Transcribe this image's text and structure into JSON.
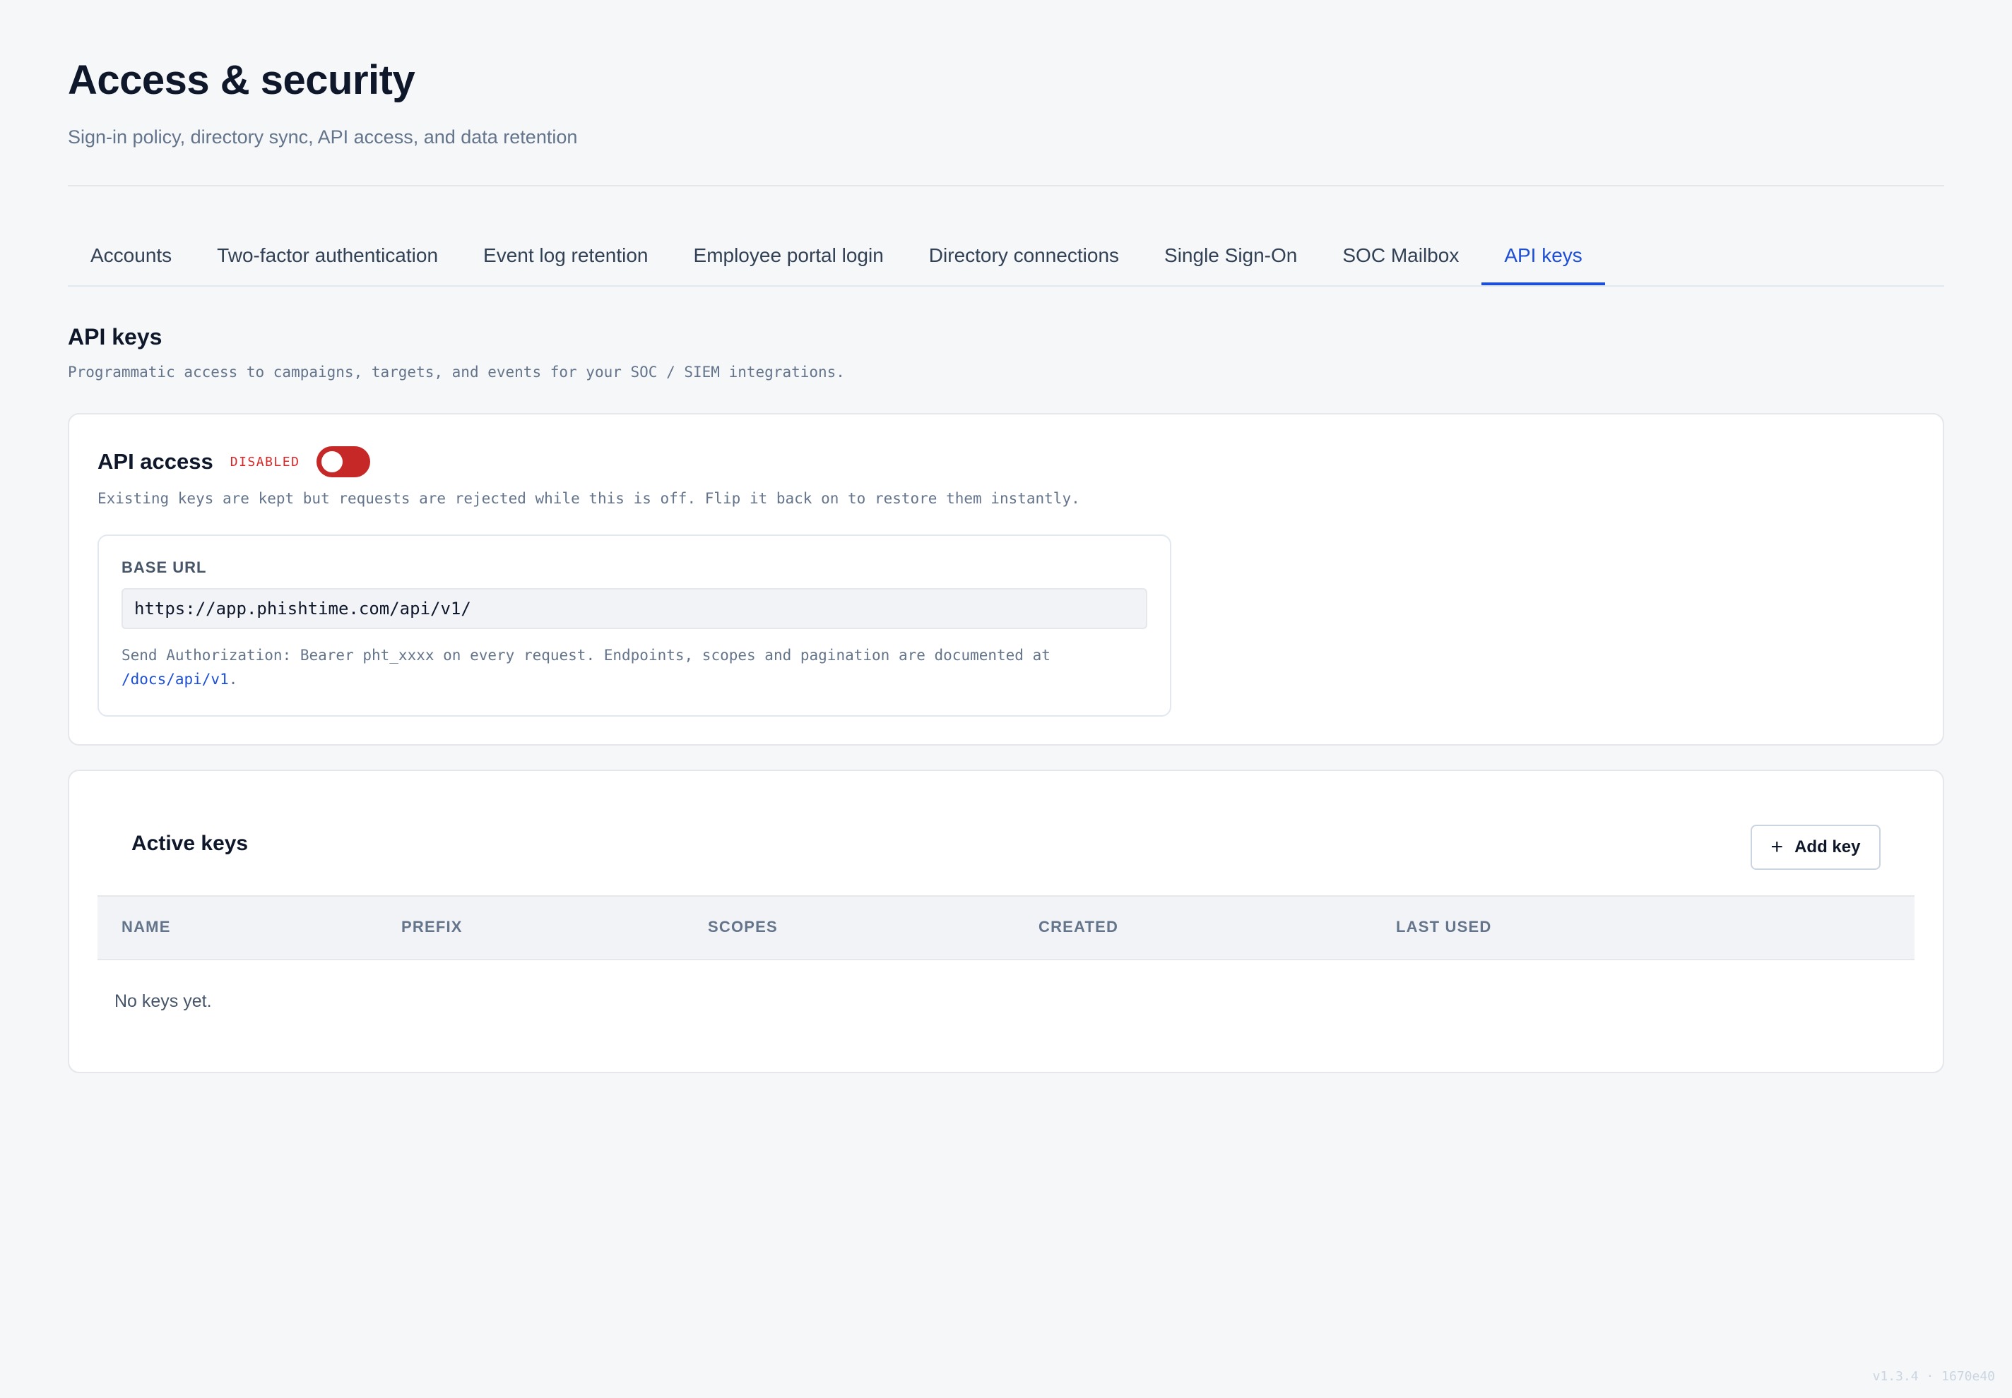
{
  "header": {
    "title": "Access & security",
    "subtitle": "Sign-in policy, directory sync, API access, and data retention"
  },
  "tabs": [
    {
      "label": "Accounts",
      "active": false
    },
    {
      "label": "Two-factor authentication",
      "active": false
    },
    {
      "label": "Event log retention",
      "active": false
    },
    {
      "label": "Employee portal login",
      "active": false
    },
    {
      "label": "Directory connections",
      "active": false
    },
    {
      "label": "Single Sign-On",
      "active": false
    },
    {
      "label": "SOC Mailbox",
      "active": false
    },
    {
      "label": "API keys",
      "active": true
    }
  ],
  "section": {
    "title": "API keys",
    "description": "Programmatic access to campaigns, targets, and events for your SOC / SIEM integrations."
  },
  "api_access": {
    "label": "API access",
    "status": "DISABLED",
    "enabled": false,
    "description": "Existing keys are kept but requests are rejected while this is off. Flip it back on to restore them instantly.",
    "base_url_label": "BASE URL",
    "base_url": "https://app.phishtime.com/api/v1/",
    "note_prefix": "Send Authorization: Bearer pht_xxxx on every request. Endpoints, scopes and pagination are documented at",
    "docs_link": "/docs/api/v1",
    "note_suffix": "."
  },
  "active_keys": {
    "title": "Active keys",
    "add_button_label": "Add key",
    "columns": [
      "NAME",
      "PREFIX",
      "SCOPES",
      "CREATED",
      "LAST USED"
    ],
    "rows": [],
    "empty_text": "No keys yet."
  },
  "footer": {
    "version": "v1.3.4 · 1670e40"
  },
  "colors": {
    "accent": "#1d4ed8",
    "danger": "#c62828",
    "background": "#f5f7f9"
  }
}
